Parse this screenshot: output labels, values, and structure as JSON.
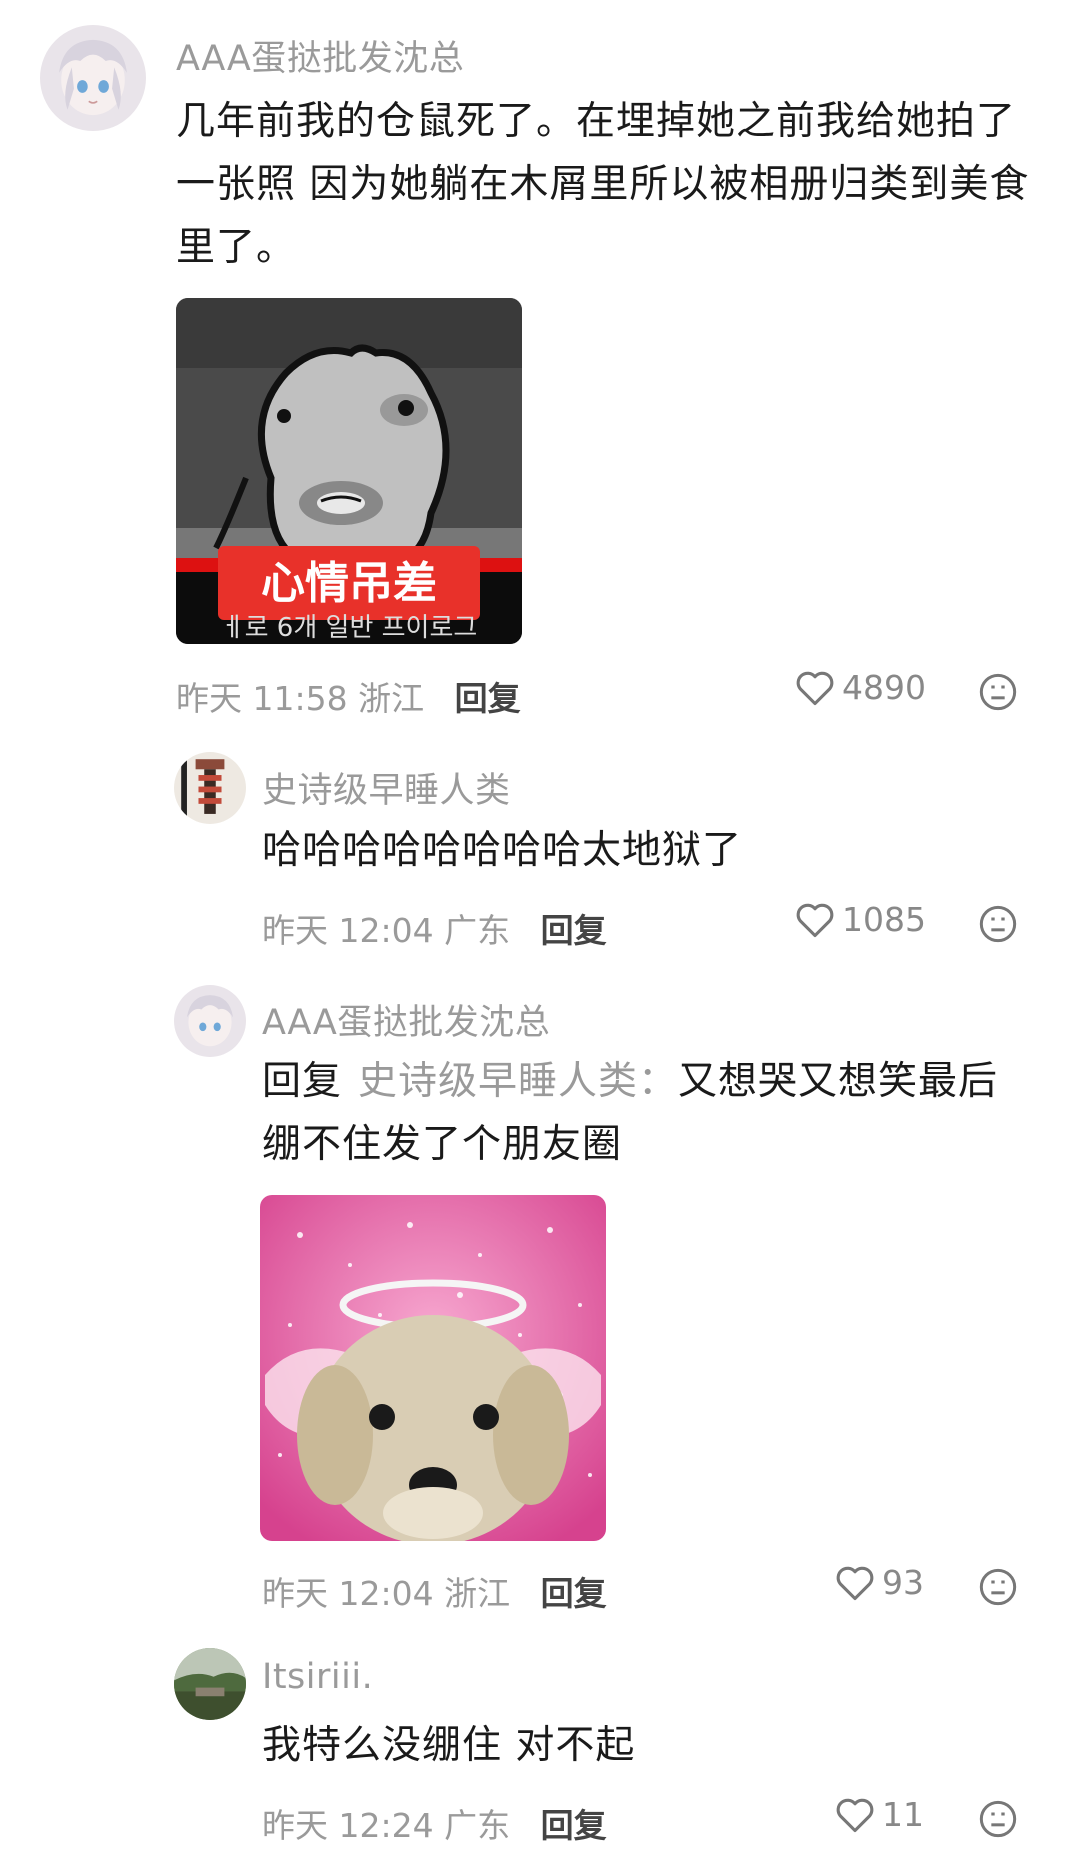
{
  "comments": [
    {
      "username": "AAA蛋挞批发沈总",
      "text_lines": [
        "几年前我的仓鼠死了。在埋掉她之前我给她拍了",
        "一张照 因为她躺在木屑里所以被相册归类到美食",
        "里了。"
      ],
      "image_caption": "心情吊差",
      "image_subcaption": "ㅔ로 6개 일반 프이로그",
      "time": "昨天 11:58",
      "location": "浙江",
      "reply_label": "回复",
      "likes": "4890"
    },
    {
      "username": "史诗级早睡人类",
      "text_lines": [
        "哈哈哈哈哈哈哈哈太地狱了"
      ],
      "time": "昨天 12:04",
      "location": "广东",
      "reply_label": "回复",
      "likes": "1085"
    },
    {
      "username": "AAA蛋挞批发沈总",
      "reply_prefix": "回复",
      "reply_target": "史诗级早睡人类：",
      "text_lines": [
        "又想哭又想笑最后",
        "绷不住发了个朋友圈"
      ],
      "time": "昨天 12:04",
      "location": "浙江",
      "reply_label": "回复",
      "likes": "93"
    },
    {
      "username": "Itsiriii.",
      "text_lines": [
        "我特么没绷住 对不起"
      ],
      "time": "昨天 12:24",
      "location": "广东",
      "reply_label": "回复",
      "likes": "11"
    }
  ],
  "colors": {
    "text": "#1a1a1a",
    "muted": "#9a9a9a",
    "caption_red": "#e8312a"
  },
  "icons": [
    "avatar-anime",
    "avatar-figurine",
    "avatar-landscape",
    "heart-icon",
    "dislike-face-icon"
  ]
}
